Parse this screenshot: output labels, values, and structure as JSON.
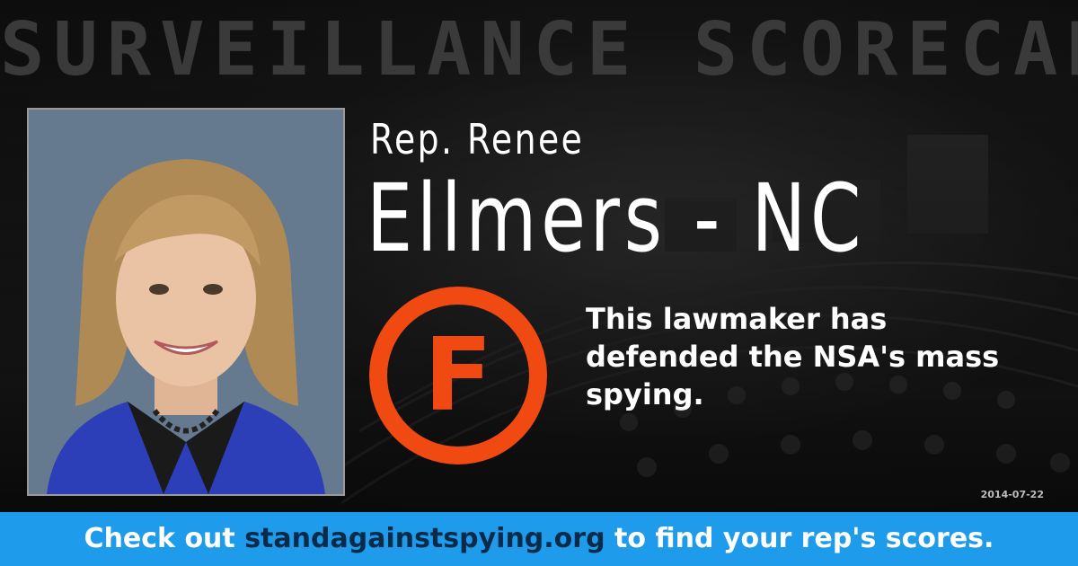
{
  "header": {
    "title": "SURVEILLANCE SCORECARD"
  },
  "representative": {
    "prefix": "Rep. Renee",
    "surname_state": "Ellmers - NC"
  },
  "grade": {
    "letter": "F",
    "color": "#f04a12"
  },
  "verdict": {
    "text": "This lawmaker has defended the NSA's mass spying."
  },
  "date": "2014-07-22",
  "footer": {
    "lead": "Check out ",
    "link": "standagainstspying.org",
    "trail": " to find your rep's scores.",
    "background": "#1e9bea"
  }
}
